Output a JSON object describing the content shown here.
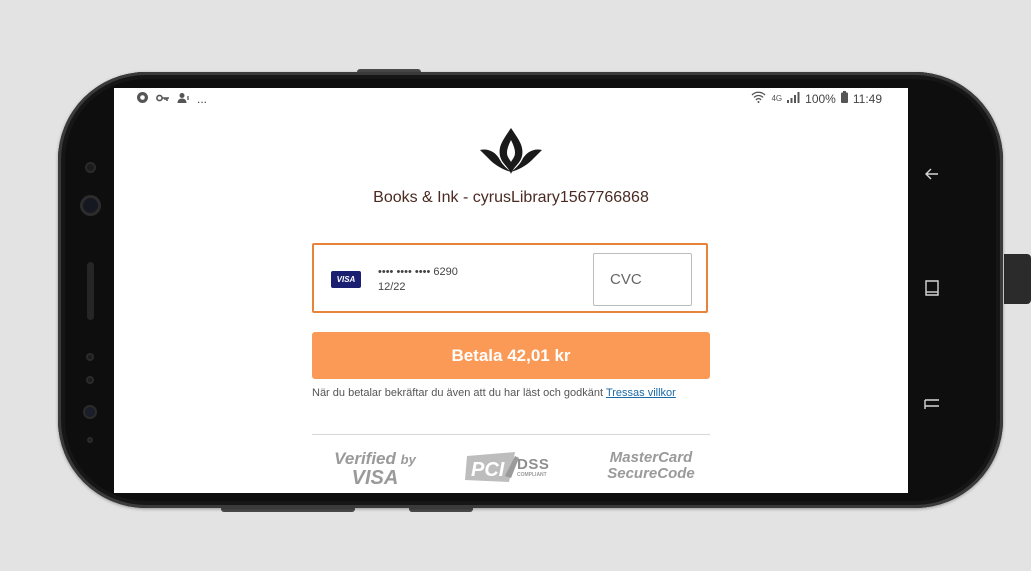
{
  "status_bar": {
    "left_icons": [
      "app-icon",
      "key-icon",
      "account-icon"
    ],
    "left_more": "...",
    "right_icons": [
      "wifi-icon",
      "signal-icon"
    ],
    "network": "4G",
    "battery_percent": "100%",
    "time": "11:49"
  },
  "merchant": {
    "logo": "lotus-logo",
    "name": "Books & Ink - cyrusLibrary1567766868"
  },
  "card": {
    "brand": "VISA",
    "number": "•••• •••• •••• 6290",
    "expiry": "12/22",
    "cvc_placeholder": "CVC",
    "cvc_value": ""
  },
  "pay_button": {
    "label": "Betala 42,01 kr"
  },
  "terms": {
    "text": "När du betalar bekräftar du även att du har läst och godkänt",
    "link": "Tressas villkor"
  },
  "trust_badges": {
    "verified_visa": {
      "line1": "Verified",
      "by": "by",
      "line2": "VISA"
    },
    "pci_dss": {
      "text": "DSS",
      "sub": "COMPLIANT"
    },
    "mastercard": {
      "line1": "MasterCard",
      "line2": "SecureCode"
    }
  },
  "system_nav": [
    "back-icon",
    "recents-icon",
    "home-icon"
  ],
  "colors": {
    "accent_orange": "#fb9a57",
    "card_border": "#e8833a",
    "link": "#1a6aa8",
    "visa_blue": "#1a1f71"
  }
}
